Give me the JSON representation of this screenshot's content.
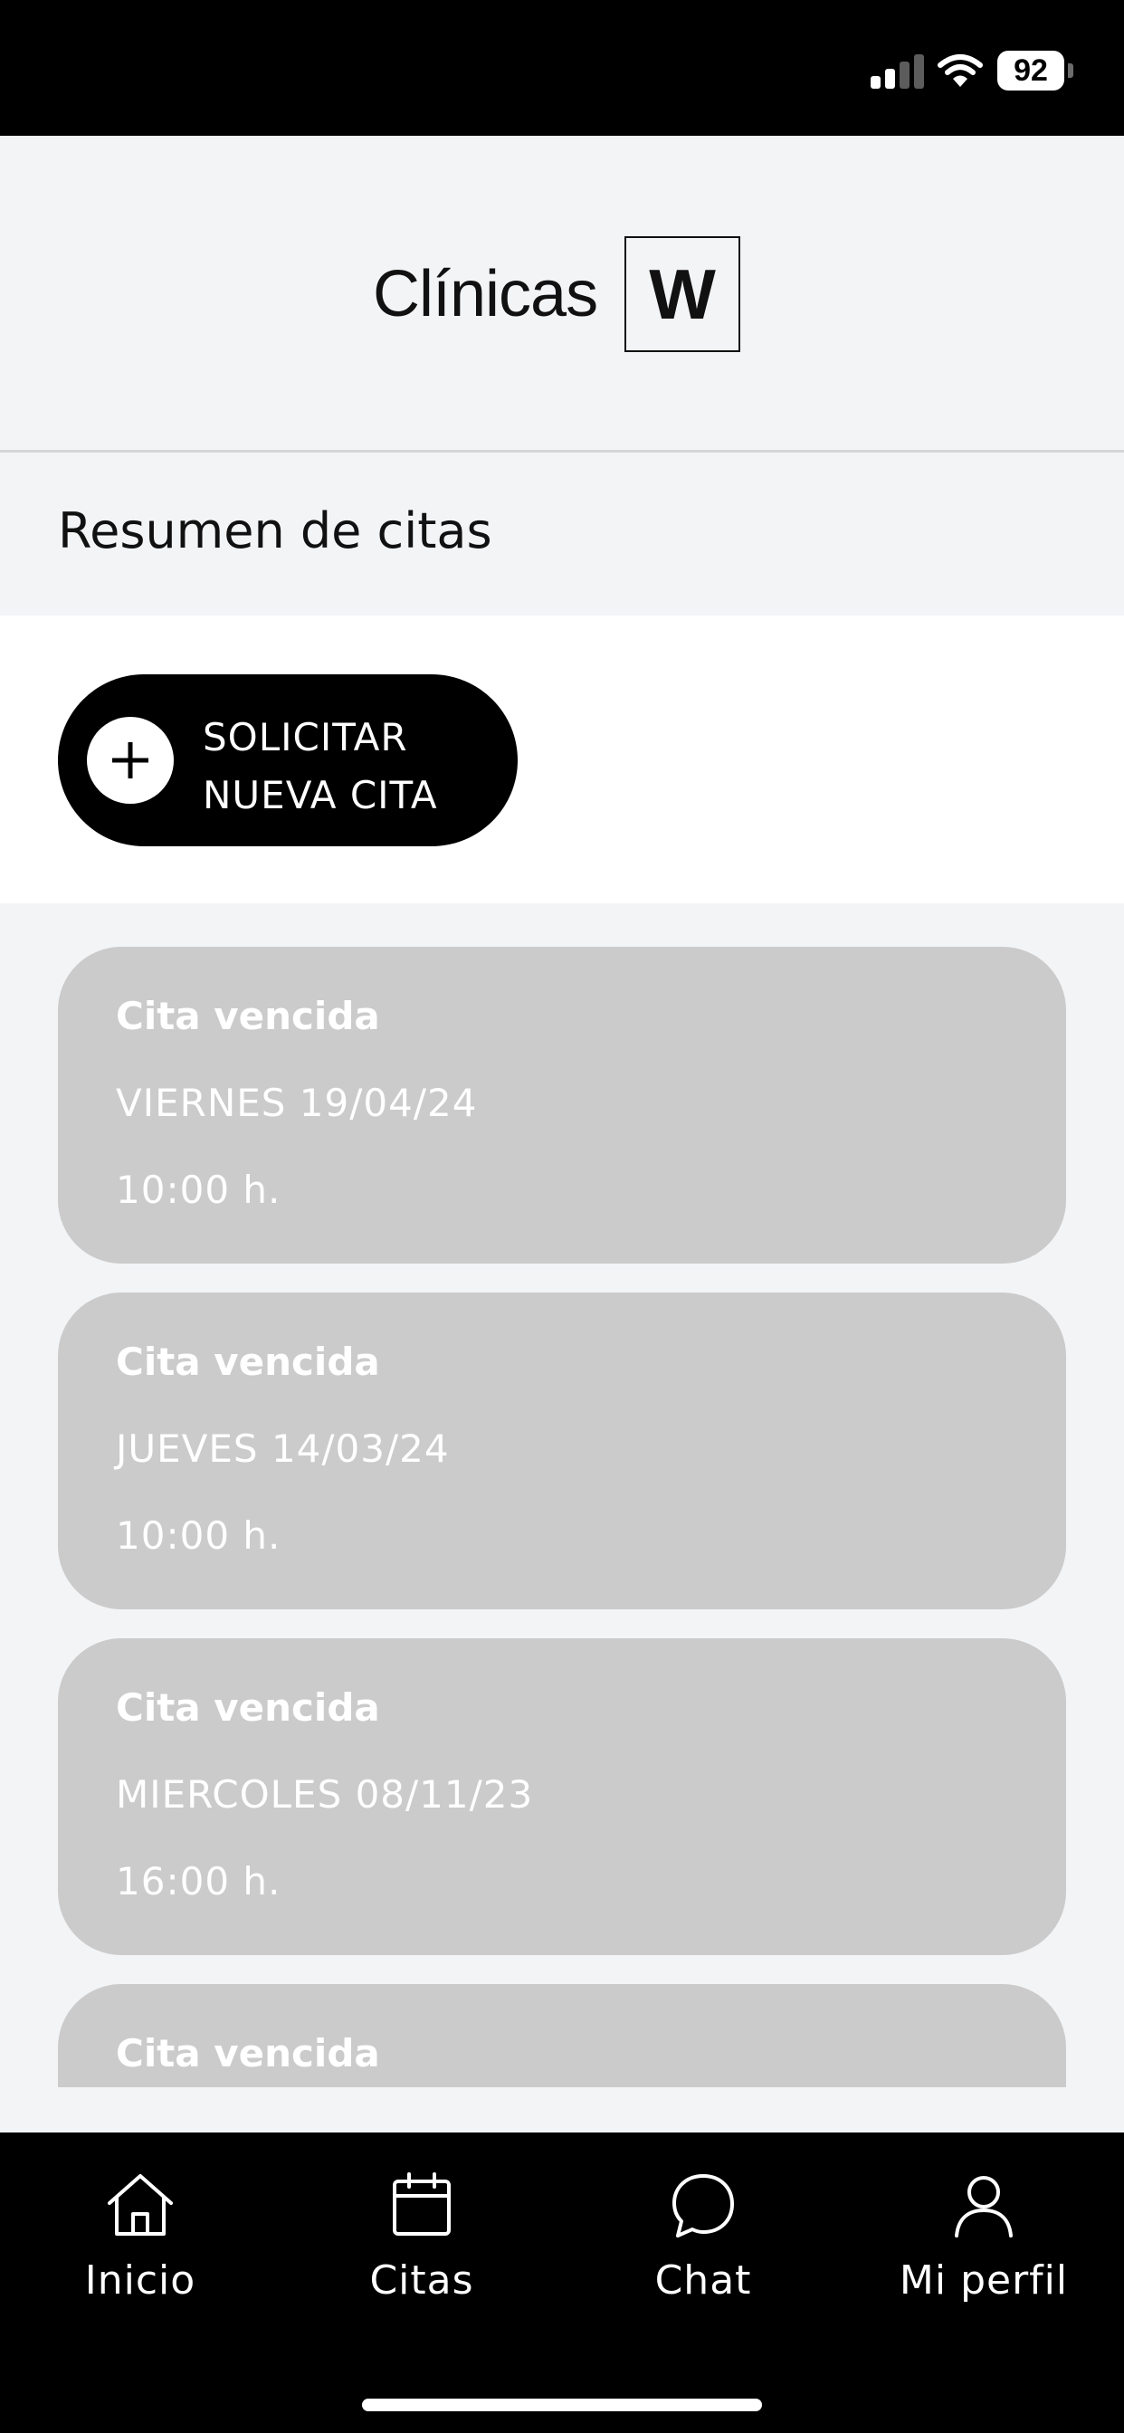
{
  "status_bar": {
    "battery": "92",
    "icons": [
      "signal-icon",
      "wifi-icon",
      "battery-icon"
    ]
  },
  "header": {
    "logo_text": "Clínicas",
    "logo_mark": "W"
  },
  "section": {
    "title": "Resumen de citas"
  },
  "actions": {
    "new_appointment_line1": "SOLICITAR",
    "new_appointment_line2": "NUEVA CITA",
    "icon": "plus-icon"
  },
  "appointments": [
    {
      "status": "Cita vencida",
      "date": "VIERNES 19/04/24",
      "time": "10:00 h."
    },
    {
      "status": "Cita vencida",
      "date": "JUEVES 14/03/24",
      "time": "10:00 h."
    },
    {
      "status": "Cita vencida",
      "date": "MIERCOLES 08/11/23",
      "time": "16:00 h."
    },
    {
      "status": "Cita vencida",
      "date": "",
      "time": ""
    }
  ],
  "colors": {
    "card_background": "#cbcbcb",
    "page_background": "#f3f4f6",
    "bar_background": "#000000",
    "text_on_card": "#ffffff"
  },
  "tab_bar": {
    "tabs": [
      {
        "label": "Inicio",
        "icon": "home-icon"
      },
      {
        "label": "Citas",
        "icon": "calendar-icon"
      },
      {
        "label": "Chat",
        "icon": "chat-icon"
      },
      {
        "label": "Mi perfil",
        "icon": "user-icon"
      }
    ]
  }
}
